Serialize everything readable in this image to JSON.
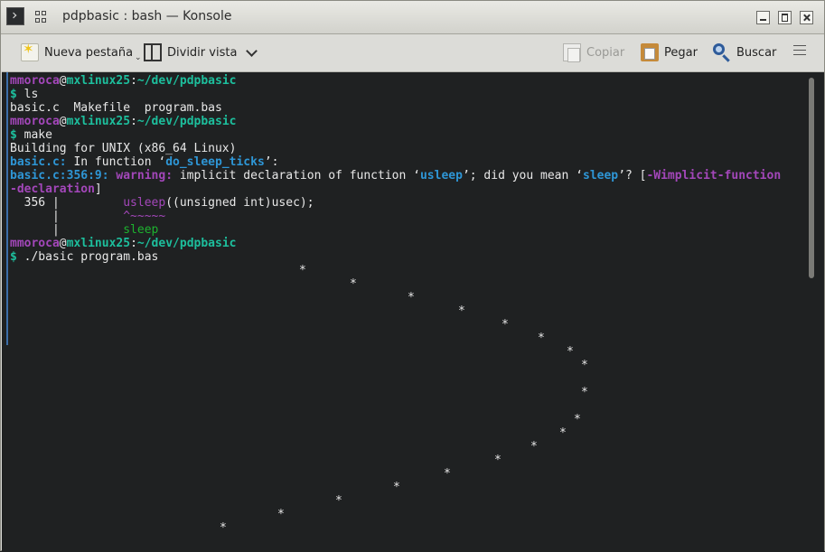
{
  "window": {
    "title": "pdpbasic : bash — Konsole",
    "icon": "terminal-icon"
  },
  "toolbar": {
    "new_tab": "Nueva pestaña",
    "split_view": "Dividir vista",
    "copy": "Copiar",
    "paste": "Pegar",
    "find": "Buscar"
  },
  "terminal": {
    "user": "mmoroca",
    "at": "@",
    "host": "mxlinux25",
    "colon": ":",
    "path": "~/dev/pdpbasic",
    "dollar": "$",
    "cmd1": " ls",
    "ls_output": "basic.c  Makefile  program.bas",
    "cmd2": " make",
    "build_line": "Building for UNIX (x86_64 Linux)",
    "fn_file": "basic.c:",
    "fn_text_pre": " In function ‘",
    "fn_name": "do_sleep_ticks",
    "fn_text_post": "’:",
    "warn_loc": "basic.c:356:9:",
    "warn_label": " warning:",
    "warn_text_pre": " implicit declaration of function ‘",
    "warn_fn": "usleep",
    "warn_text_mid": "’; did you mean ‘",
    "warn_suggest": "sleep",
    "warn_text_post": "’? [",
    "warn_flag_a": "-Wimplicit-function",
    "warn_flag_b": "-declaration",
    "warn_flag_close": "]",
    "code_gutter": "  356 |         ",
    "code_call": "usleep",
    "code_rest": "((unsigned int)usec);",
    "caret_gutter": "      |         ",
    "caret_text": "^~~~~~",
    "fix_gutter": "      |         ",
    "fix_text": "sleep",
    "cmd3": " ./basic program.bas",
    "star_char": "*"
  }
}
